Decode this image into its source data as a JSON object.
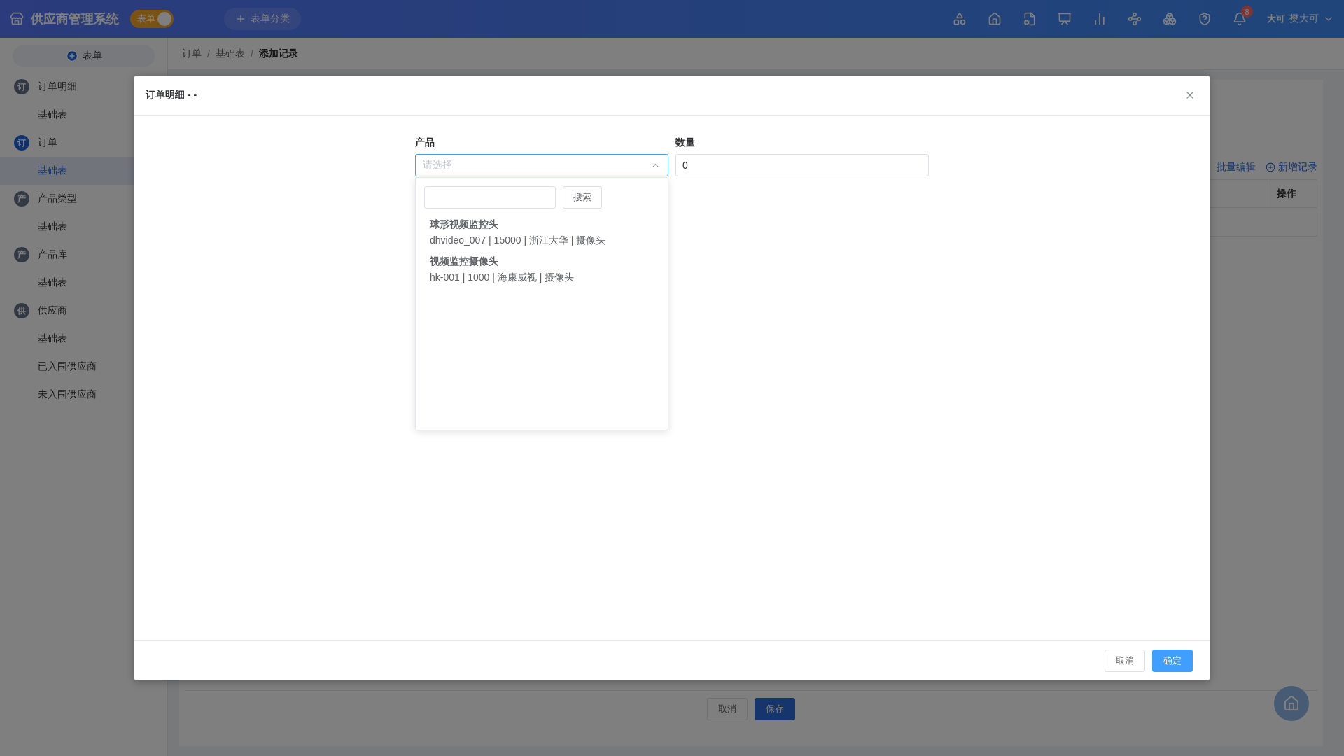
{
  "header": {
    "title": "供应商管理系统",
    "mode_toggle": {
      "label": "表单",
      "on": true
    },
    "category_button": "表单分类",
    "notification_count": "8",
    "user": {
      "avatar": "大可",
      "name": "樊大可"
    }
  },
  "sidebar": {
    "new_button": "表单",
    "groups": [
      {
        "badge": "订",
        "label": "订单明细",
        "selected": false,
        "children": [
          {
            "label": "基础表",
            "selected": false
          }
        ]
      },
      {
        "badge": "订",
        "label": "订单",
        "selected": true,
        "children": [
          {
            "label": "基础表",
            "selected": true
          }
        ]
      },
      {
        "badge": "产",
        "label": "产品类型",
        "selected": false,
        "children": [
          {
            "label": "基础表",
            "selected": false
          }
        ]
      },
      {
        "badge": "产",
        "label": "产品库",
        "selected": false,
        "children": [
          {
            "label": "基础表",
            "selected": false
          }
        ]
      },
      {
        "badge": "供",
        "label": "供应商",
        "selected": false,
        "children": [
          {
            "label": "基础表",
            "selected": false
          },
          {
            "label": "已入围供应商",
            "selected": false
          },
          {
            "label": "未入围供应商",
            "selected": false
          }
        ]
      }
    ]
  },
  "breadcrumb": {
    "separator": "/",
    "items": [
      "订单",
      "基础表",
      "添加记录"
    ]
  },
  "content": {
    "actions": [
      "批量编辑",
      "新增记录"
    ],
    "table": {
      "columns": [
        "操作"
      ]
    },
    "buttons": [
      "取消",
      "保存"
    ]
  },
  "dialog": {
    "title": "订单明细 - -",
    "fields": [
      {
        "kind": "select",
        "label": "产品",
        "placeholder": "请选择",
        "expanded": true,
        "dropdown": {
          "search_button": "搜索",
          "options": [
            {
              "title": "球形视频监控头",
              "detail": "dhvideo_007 | 15000 | 浙江大华 | 摄像头"
            },
            {
              "title": "视频监控摄像头",
              "detail": "hk-001 | 1000 | 海康威视 | 摄像头"
            }
          ]
        }
      },
      {
        "kind": "input",
        "label": "数量",
        "value": "0"
      }
    ],
    "buttons": [
      "取消",
      "确定"
    ]
  }
}
